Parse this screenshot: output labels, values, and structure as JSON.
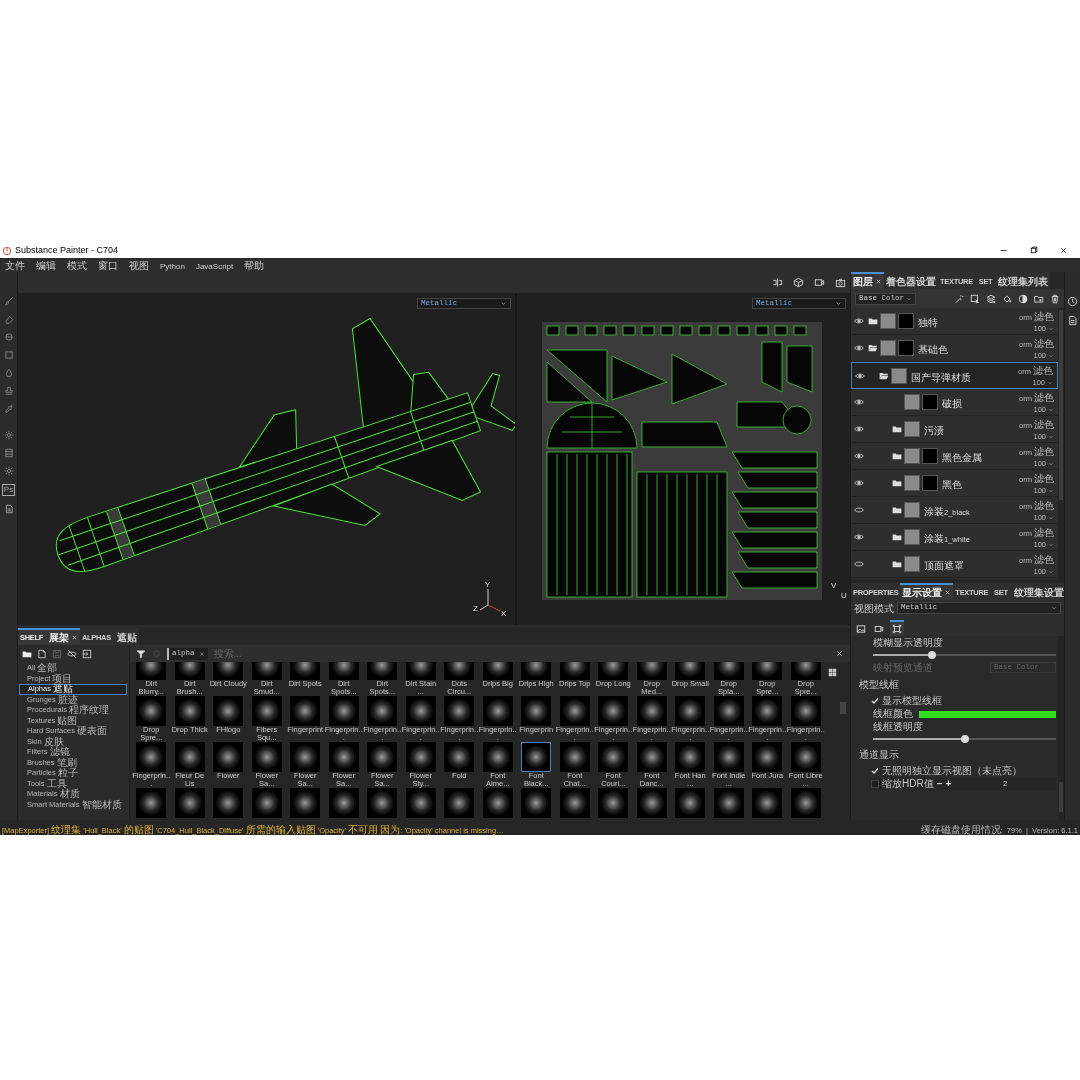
{
  "window": {
    "title": "Substance Painter - C704"
  },
  "menu": [
    "文件",
    "编辑",
    "模式",
    "窗口",
    "视图",
    "Python",
    "JavaScript",
    "帮助"
  ],
  "tool_badge": "Ps",
  "viewport_3d": {
    "mode": "Metallic",
    "axes": [
      "Y",
      "Z",
      "X"
    ]
  },
  "viewport_2d": {
    "mode": "Metallic",
    "axes": [
      "V",
      "U"
    ]
  },
  "layers_panel": {
    "tabs": [
      {
        "label": "图层",
        "selected": true,
        "closable": true
      },
      {
        "label": "着色器设置",
        "selected": false,
        "closable": false
      },
      {
        "label": "TEXTURE SET 纹理集列表",
        "selected": false,
        "closable": false
      }
    ],
    "channel": "Base Color",
    "layers": [
      {
        "name": "独特",
        "kind": "folder",
        "visible": true,
        "selected": false,
        "has_mask": true,
        "expanded": false,
        "blend": "orm 滤色",
        "opacity": "100"
      },
      {
        "name": "基础色",
        "kind": "folder",
        "visible": true,
        "selected": false,
        "has_mask": true,
        "expanded": true,
        "blend": "orm 滤色",
        "opacity": "100",
        "children": [
          {
            "name": "国产导弹材质",
            "kind": "folder",
            "visible": true,
            "selected": true,
            "has_mask": false,
            "expanded": true,
            "blend": "orm 滤色",
            "opacity": "100",
            "children": [
              {
                "name": "破损",
                "kind": "fill",
                "visible": true,
                "selected": false,
                "has_mask": true,
                "blend": "orm 滤色",
                "opacity": "100"
              },
              {
                "name": "污渍",
                "kind": "folder",
                "visible": true,
                "selected": false,
                "has_mask": false,
                "expanded": false,
                "blend": "orm 滤色",
                "opacity": "100"
              },
              {
                "name": "黑色金属",
                "kind": "folder",
                "visible": true,
                "selected": false,
                "has_mask": true,
                "expanded": false,
                "blend": "orm 滤色",
                "opacity": "100"
              },
              {
                "name": "黑色",
                "kind": "folder",
                "visible": true,
                "selected": false,
                "has_mask": true,
                "expanded": false,
                "blend": "orm 滤色",
                "opacity": "100"
              },
              {
                "name": "涂装2_black",
                "kind": "folder",
                "visible": false,
                "selected": false,
                "has_mask": false,
                "expanded": false,
                "blend": "orm 滤色",
                "opacity": "100"
              },
              {
                "name": "涂装1_white",
                "kind": "folder",
                "visible": true,
                "selected": false,
                "has_mask": false,
                "expanded": false,
                "blend": "orm 滤色",
                "opacity": "100"
              },
              {
                "name": "顶面遮罩",
                "kind": "folder",
                "visible": false,
                "selected": false,
                "has_mask": false,
                "expanded": false,
                "blend": "orm 滤色",
                "opacity": "100"
              }
            ]
          }
        ]
      }
    ]
  },
  "properties_panel": {
    "tabs": [
      {
        "label": "PROPERTIES",
        "selected": false,
        "closable": false
      },
      {
        "label": "显示设置",
        "selected": true,
        "closable": true
      },
      {
        "label": "TEXTURE SET 纹理集设置",
        "selected": false,
        "closable": false
      }
    ],
    "view_mode_label": "视图模式",
    "view_mode": "Metallic",
    "icon_tabs": [
      {
        "kind": "image",
        "selected": false
      },
      {
        "kind": "camera",
        "selected": false
      },
      {
        "kind": "frame",
        "selected": true
      }
    ],
    "settings": [
      {
        "kind": "slider",
        "label": "模糊显示透明度",
        "level": 0.32
      },
      {
        "kind": "select",
        "label": "映射预览通道",
        "value": "Base Color",
        "disabled": true
      },
      {
        "kind": "heading",
        "label": "模型线框"
      },
      {
        "kind": "checkbox",
        "label": "显示模型线框",
        "checked": true
      },
      {
        "kind": "color",
        "label": "线框颜色",
        "color": "#33dd22"
      },
      {
        "kind": "slider",
        "label": "线框透明度",
        "level": 0.5
      },
      {
        "kind": "heading",
        "label": "通道显示"
      },
      {
        "kind": "checkbox",
        "label": "无照明独立显示视图（未点亮）",
        "checked": true
      },
      {
        "kind": "stepper",
        "label": "缩放HDR值",
        "checked": false,
        "minus": "−",
        "plus": "+",
        "value": "2"
      }
    ]
  },
  "shelf": {
    "tabs": [
      {
        "label": "SHELF 展架",
        "selected": true,
        "closable": true
      },
      {
        "label": "ALPHAS 遮贴",
        "selected": false,
        "closable": false
      }
    ],
    "categories": [
      {
        "label": "All 全部",
        "selected": false
      },
      {
        "label": "Project 项目",
        "selected": false
      },
      {
        "label": "Alphas 遮贴",
        "selected": true
      },
      {
        "label": "Grunges 脏迹",
        "selected": false
      },
      {
        "label": "Procedurals 程序纹理",
        "selected": false
      },
      {
        "label": "Textures 贴图",
        "selected": false
      },
      {
        "label": "Hard Surfaces 硬表面",
        "selected": false
      },
      {
        "label": "Skin 皮肤",
        "selected": false
      },
      {
        "label": "Filters 滤镜",
        "selected": false
      },
      {
        "label": "Brushes 笔刷",
        "selected": false
      },
      {
        "label": "Particles 粒子",
        "selected": false
      },
      {
        "label": "Tools 工具",
        "selected": false
      },
      {
        "label": "Materials 材质",
        "selected": false
      },
      {
        "label": "Smart Materials 智能材质",
        "selected": false
      }
    ],
    "filter_chip": "alpha",
    "search": {
      "placeholder": "搜索..."
    },
    "items": [
      {
        "kind": "labeled",
        "label": "Dirt Blurry...",
        "selected": false
      },
      {
        "kind": "labeled",
        "label": "Dirt Brush...",
        "selected": false
      },
      {
        "kind": "labeled",
        "label": "Dirt Cloudy",
        "selected": false
      },
      {
        "kind": "labeled",
        "label": "Dirt Smud...",
        "selected": false
      },
      {
        "kind": "labeled",
        "label": "Dirt Spots",
        "selected": false
      },
      {
        "kind": "labeled",
        "label": "Dirt Spots...",
        "selected": false
      },
      {
        "kind": "labeled",
        "label": "Dirt Spots...",
        "selected": false
      },
      {
        "kind": "labeled",
        "label": "Dirt Stain ...",
        "selected": false
      },
      {
        "kind": "labeled",
        "label": "Dots Circu...",
        "selected": false
      },
      {
        "kind": "labeled",
        "label": "Drips Big",
        "selected": false
      },
      {
        "kind": "labeled",
        "label": "Drips High",
        "selected": false
      },
      {
        "kind": "labeled",
        "label": "Drips Top",
        "selected": false
      },
      {
        "kind": "labeled",
        "label": "Drop Long",
        "selected": false
      },
      {
        "kind": "labeled",
        "label": "Drop Med...",
        "selected": false
      },
      {
        "kind": "labeled",
        "label": "Drop Small",
        "selected": false
      },
      {
        "kind": "labeled",
        "label": "Drop Spla...",
        "selected": false
      },
      {
        "kind": "labeled",
        "label": "Drop Spre...",
        "selected": false
      },
      {
        "kind": "labeled",
        "label": "Drop Spre...",
        "selected": false
      },
      {
        "kind": "labeled",
        "label": "Drop Spre...",
        "selected": false
      },
      {
        "kind": "labeled",
        "label": "Drop Thick",
        "selected": false
      },
      {
        "kind": "labeled",
        "label": "FHlogo",
        "selected": false
      },
      {
        "kind": "labeled",
        "label": "Fibers Squ...",
        "selected": false
      },
      {
        "kind": "labeled",
        "label": "Fingerprint",
        "selected": false
      },
      {
        "kind": "labeled",
        "label": "Fingerprin...",
        "selected": false
      },
      {
        "kind": "labeled",
        "label": "Fingerprin...",
        "selected": false
      },
      {
        "kind": "labeled",
        "label": "Fingerprin...",
        "selected": false
      },
      {
        "kind": "labeled",
        "label": "Fingerprin...",
        "selected": false
      },
      {
        "kind": "labeled",
        "label": "Fingerprin...",
        "selected": false
      },
      {
        "kind": "labeled",
        "label": "Fingerprin",
        "selected": false
      },
      {
        "kind": "labeled",
        "label": "Fingerprin...",
        "selected": false
      },
      {
        "kind": "labeled",
        "label": "Fingerprin...",
        "selected": false
      },
      {
        "kind": "labeled",
        "label": "Fingerprin...",
        "selected": false
      },
      {
        "kind": "labeled",
        "label": "Fingerprin...",
        "selected": false
      },
      {
        "kind": "labeled",
        "label": "Fingerprin...",
        "selected": false
      },
      {
        "kind": "labeled",
        "label": "Fingerprin...",
        "selected": false
      },
      {
        "kind": "labeled",
        "label": "Fingerprin...",
        "selected": false
      },
      {
        "kind": "labeled",
        "label": "Fingerprin...",
        "selected": false
      },
      {
        "kind": "labeled",
        "label": "Fleur De Lis",
        "selected": false
      },
      {
        "kind": "labeled",
        "label": "Flower",
        "selected": false
      },
      {
        "kind": "labeled",
        "label": "Flower Sa...",
        "selected": false
      },
      {
        "kind": "labeled",
        "label": "Flower Sa...",
        "selected": false
      },
      {
        "kind": "labeled",
        "label": "Flower Sa...",
        "selected": false
      },
      {
        "kind": "labeled",
        "label": "Flower Sa...",
        "selected": false
      },
      {
        "kind": "labeled",
        "label": "Flower Sty...",
        "selected": false
      },
      {
        "kind": "labeled",
        "label": "Fold",
        "selected": false
      },
      {
        "kind": "labeled",
        "label": "Font Alme...",
        "selected": false
      },
      {
        "kind": "labeled",
        "label": "Font Black...",
        "selected": true
      },
      {
        "kind": "labeled",
        "label": "Font Chat...",
        "selected": false
      },
      {
        "kind": "labeled",
        "label": "Font Couri...",
        "selected": false
      },
      {
        "kind": "labeled",
        "label": "Font Danc...",
        "selected": false
      },
      {
        "kind": "labeled",
        "label": "Font Han ...",
        "selected": false
      },
      {
        "kind": "labeled",
        "label": "Font Indie ...",
        "selected": false
      },
      {
        "kind": "labeled",
        "label": "Font Jura",
        "selected": false
      },
      {
        "kind": "labeled",
        "label": "Font Libre ...",
        "selected": false
      },
      {
        "kind": "cut",
        "selected": false
      },
      {
        "kind": "cut",
        "selected": false
      },
      {
        "kind": "cut",
        "selected": false
      },
      {
        "kind": "cut",
        "selected": false
      },
      {
        "kind": "cut",
        "selected": false
      },
      {
        "kind": "cut",
        "selected": false
      },
      {
        "kind": "cut",
        "selected": false
      },
      {
        "kind": "cut",
        "selected": false
      },
      {
        "kind": "cut",
        "selected": false
      },
      {
        "kind": "cut",
        "selected": false
      },
      {
        "kind": "cut",
        "selected": false
      },
      {
        "kind": "cut",
        "selected": false
      },
      {
        "kind": "cut",
        "selected": false
      },
      {
        "kind": "cut",
        "selected": false
      },
      {
        "kind": "cut",
        "selected": false
      },
      {
        "kind": "cut",
        "selected": false
      },
      {
        "kind": "cut",
        "selected": false
      },
      {
        "kind": "cut",
        "selected": false
      }
    ]
  },
  "status_bar": {
    "log": "[MapExporter] 纹理集 'Hull_Black' 的贴图 'C704_Hull_Black_Diffuse' 所需的输入贴图 'Opacity' 不可用 因为: 'Opacity' channel is missing…",
    "info": "缓存磁盘使用情况:  79%  |  Version: 6.1.1"
  }
}
